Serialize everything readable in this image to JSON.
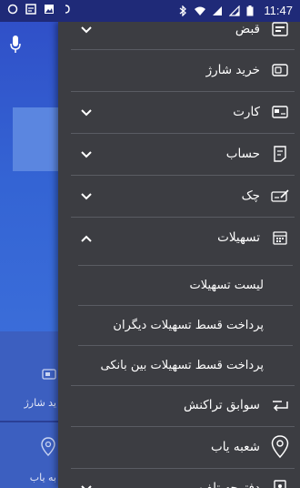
{
  "status_bar": {
    "time": "11:47",
    "left_icons": [
      "circle-outline-icon",
      "app-box-icon",
      "image-icon",
      "notification-icon"
    ],
    "right_icons": [
      "bluetooth-icon",
      "wifi-icon",
      "signal-icon",
      "signal-icon",
      "battery-icon"
    ]
  },
  "background_app": {
    "item_1_label": "ید شارژ",
    "item_2_label": "به یاب"
  },
  "drawer": {
    "items": [
      {
        "label": "قبض",
        "icon": "bill-icon",
        "expandable": true,
        "expanded": false
      },
      {
        "label": "خرید شارژ",
        "icon": "sim-card-icon",
        "expandable": false
      },
      {
        "label": "کارت",
        "icon": "card-icon",
        "expandable": true,
        "expanded": false
      },
      {
        "label": "حساب",
        "icon": "account-icon",
        "expandable": true,
        "expanded": false
      },
      {
        "label": "چک",
        "icon": "cheque-icon",
        "expandable": true,
        "expanded": false
      },
      {
        "label": "تسهیلات",
        "icon": "loan-icon",
        "expandable": true,
        "expanded": true
      },
      {
        "label": "سوابق تراکنش",
        "icon": "transfer-icon",
        "expandable": false
      },
      {
        "label": "شعبه یاب",
        "icon": "location-pin-icon",
        "expandable": false
      },
      {
        "label": "دفترچه تلفن",
        "icon": "phonebook-icon",
        "expandable": true,
        "expanded": false
      }
    ],
    "subitems": [
      {
        "label": "لیست تسهیلات"
      },
      {
        "label": "پرداخت قسط تسهیلات دیگران"
      },
      {
        "label": "پرداخت قسط تسهیلات بین بانکی"
      }
    ]
  },
  "colors": {
    "drawer_bg": "#3c3d42",
    "status_bar_bg": "#1f2a78",
    "accent_blue": "#3464d4"
  }
}
